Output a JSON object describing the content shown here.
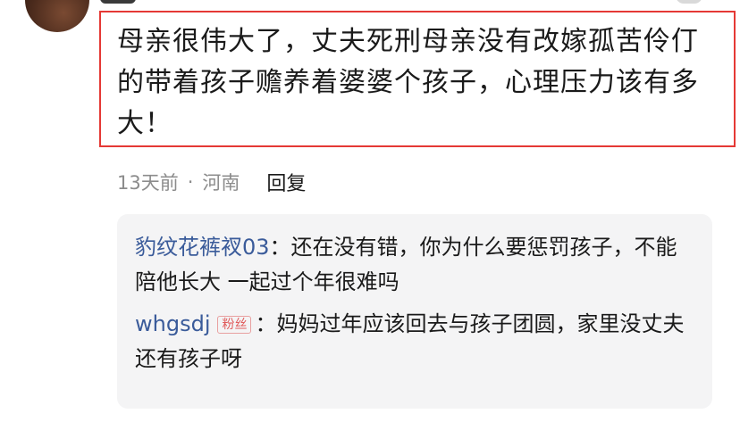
{
  "comment": {
    "text": "母亲很伟大了，丈夫死刑母亲没有改嫁孤苦伶仃的带着孩子赡养着婆婆个孩子，心理压力该有多大！",
    "time": "13天前",
    "separator": "·",
    "location": "河南",
    "reply_label": "回复"
  },
  "replies": [
    {
      "author": "豹纹花裤衩03",
      "colon": "：",
      "text": "还在没有错，你为什么要惩罚孩子，不能陪他长大 一起过个年很难吗"
    },
    {
      "author": "whgsdj",
      "badge": "粉丝",
      "colon": "：",
      "text": "妈妈过年应该回去与孩子团圆，家里没丈夫还有孩子呀"
    }
  ],
  "colors": {
    "highlight_border": "#e53935",
    "author_link": "#3a5b9a",
    "meta_text": "#8c8c8c",
    "reply_bg": "#f4f4f5",
    "badge": "#e05a5a"
  }
}
